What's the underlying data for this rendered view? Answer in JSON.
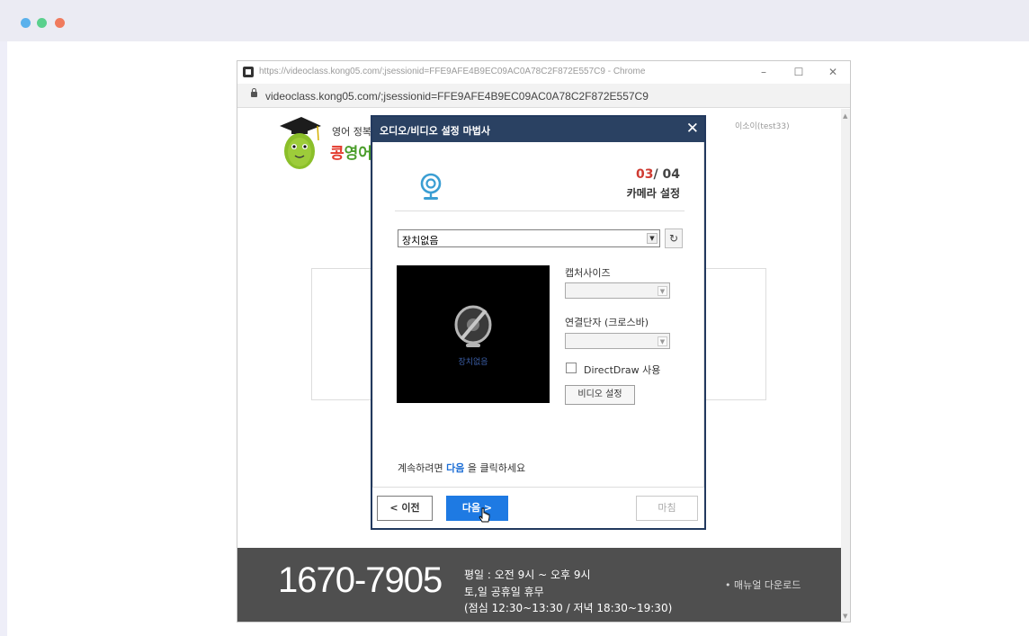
{
  "chrome": {
    "title": "https://videoclass.kong05.com/;jsessionid=FFE9AFE4B9EC09AC0A78C2F872E557C9 - Chrome",
    "address": "videoclass.kong05.com/;jsessionid=FFE9AFE4B9EC09AC0A78C2F872E557C9",
    "min_glyph": "–",
    "max_glyph": "☐",
    "close_glyph": "✕"
  },
  "page": {
    "logo_sub": "영어 정복",
    "logo_main_first": "콩",
    "logo_main_rest": "영어",
    "user_name": "이소이(test33)"
  },
  "dialog": {
    "title": "오디오/비디오 설정 마법사",
    "close_glyph": "✕",
    "step_current": "03",
    "step_total": "/ 04",
    "step_title": "카메라 설정",
    "device_select_value": "장치없음",
    "refresh_glyph": "↻",
    "no_device_label": "장치없음",
    "capture_size_label": "캡처사이즈",
    "connector_label": "연결단자 (크로스바)",
    "directdraw_label": "DirectDraw 사용",
    "video_settings_label": "비디오 설정",
    "hint_prefix": "계속하려면",
    "hint_accent": "다음",
    "hint_suffix": "을 클릭하세요",
    "prev_label": "< 이전",
    "next_label": "다음 >",
    "finish_label": "마침",
    "colors": {
      "titlebar": "#2a4162",
      "next_button": "#1e7ae3",
      "step_current": "#cf3b32"
    }
  },
  "footer": {
    "phone": "1670-7905",
    "hours_1": "평일 : 오전 9시 ~ 오후 9시",
    "hours_2": "토,일 공휴일 휴무",
    "hours_3": "(점심 12:30~13:30 / 저녁 18:30~19:30)",
    "manual_link": "• 매뉴얼 다운로드"
  },
  "icons": [
    "webcam-icon",
    "no-device-icon",
    "lock-icon",
    "mascot-icon",
    "refresh-icon",
    "cursor-icon"
  ]
}
